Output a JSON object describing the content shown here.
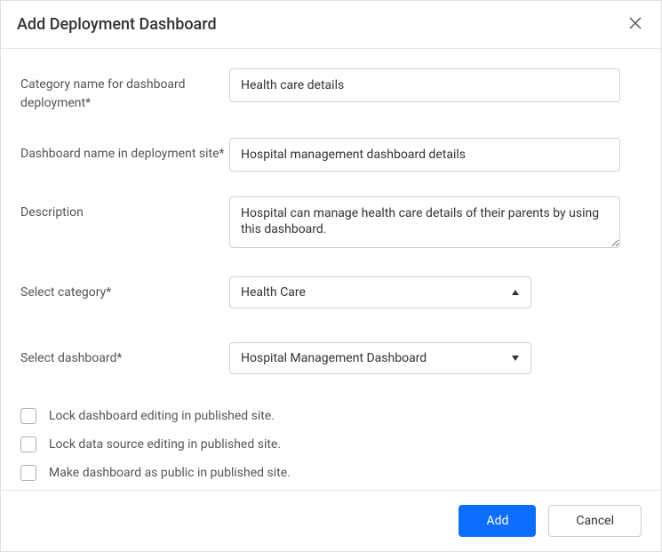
{
  "dialog": {
    "title": "Add Deployment Dashboard"
  },
  "fields": {
    "category_name": {
      "label": "Category name for dashboard deployment*",
      "value": "Health care details"
    },
    "dashboard_name": {
      "label": "Dashboard name in deployment site*",
      "value": "Hospital management dashboard details"
    },
    "description": {
      "label": "Description",
      "value": "Hospital can manage health care details of their parents by using this dashboard."
    },
    "select_category": {
      "label": "Select category*",
      "value": "Health Care"
    },
    "select_dashboard": {
      "label": "Select dashboard*",
      "value": "Hospital Management Dashboard"
    }
  },
  "checkboxes": {
    "lock_dashboard": "Lock dashboard editing in published site.",
    "lock_datasource": "Lock data source editing in published site.",
    "make_public": "Make dashboard as public in published site."
  },
  "footer": {
    "add": "Add",
    "cancel": "Cancel"
  }
}
